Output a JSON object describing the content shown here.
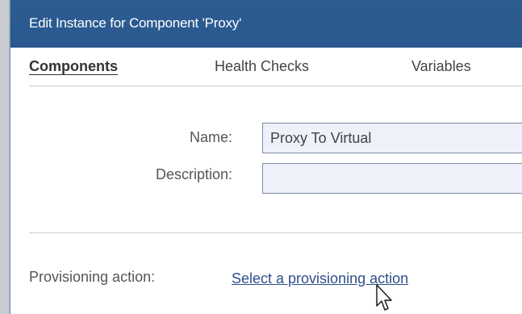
{
  "dialog": {
    "title": "Edit Instance for Component 'Proxy'"
  },
  "tabs": [
    {
      "label": "Components",
      "active": true
    },
    {
      "label": "Health Checks",
      "active": false
    },
    {
      "label": "Variables",
      "active": false
    }
  ],
  "form": {
    "name_label": "Name:",
    "name_value": "Proxy To Virtual",
    "description_label": "Description:",
    "description_value": ""
  },
  "provisioning": {
    "label": "Provisioning action:",
    "link_text": "Select a provisioning action"
  },
  "colors": {
    "titlebar": "#2d5c93",
    "link": "#2f4f8a",
    "field_bg": "#eef0fa"
  },
  "icons": {
    "cursor": "mouse-pointer-icon"
  }
}
